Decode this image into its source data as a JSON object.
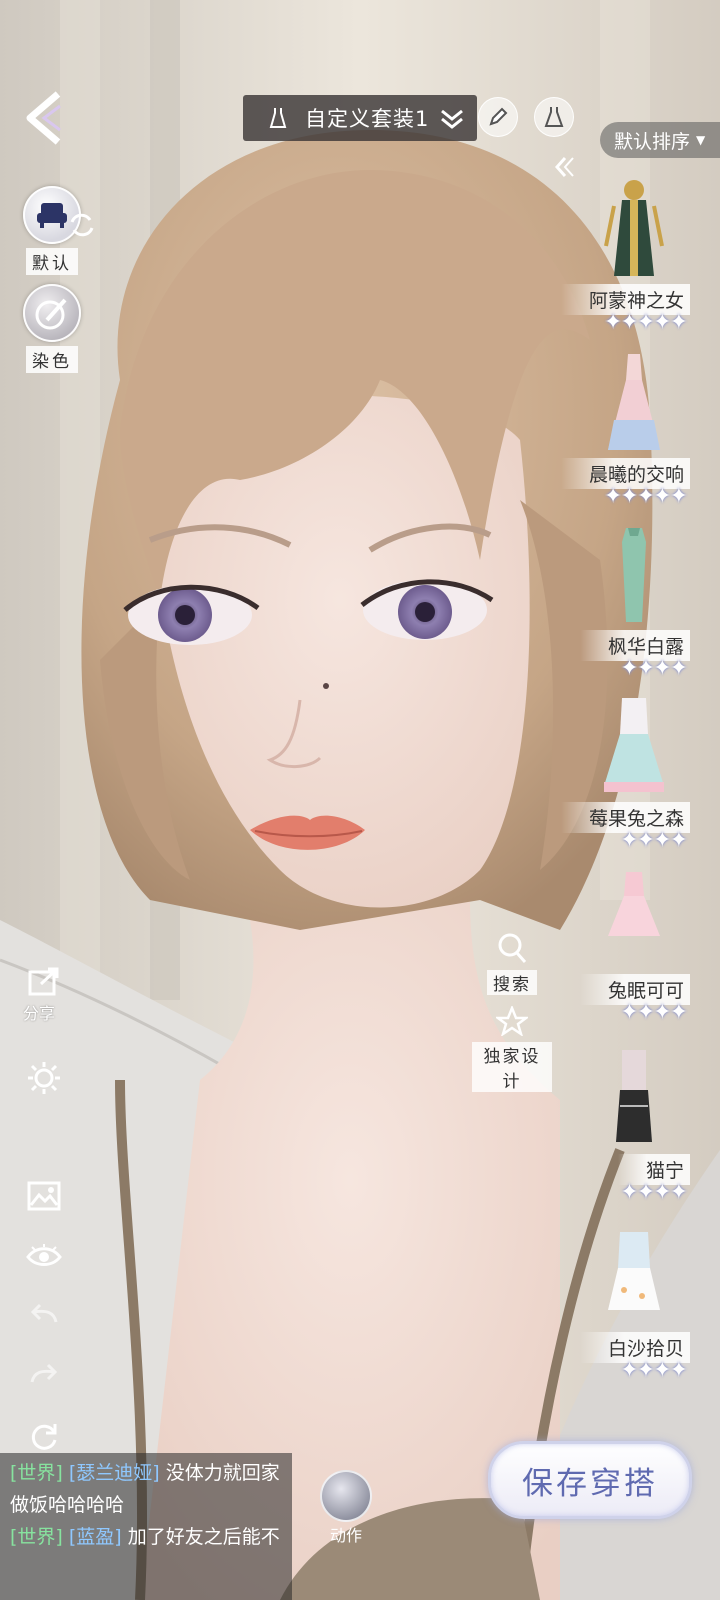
{
  "header": {
    "outfit_name": "自定义套装1",
    "sort_label": "默认排序"
  },
  "left_tools": [
    {
      "name": "default",
      "label": "默认",
      "icon": "sofa-icon"
    },
    {
      "name": "dye",
      "label": "染色",
      "icon": "palette-icon"
    }
  ],
  "side_icons": {
    "share_label": "分享",
    "icons": [
      "share-icon",
      "brightness-icon",
      "image-icon",
      "eye-icon",
      "undo-icon",
      "redo-icon",
      "reset-icon"
    ]
  },
  "outfits": [
    {
      "name": "阿蒙神之女",
      "stars": "✦✦✦✦✦",
      "star_count": 5
    },
    {
      "name": "晨曦的交响",
      "stars": "✦✦✦✦✦",
      "star_count": 5
    },
    {
      "name": "枫华白露",
      "stars": "✦✦✦✦",
      "star_count": 4
    },
    {
      "name": "莓果兔之森",
      "stars": "✦✦✦✦",
      "star_count": 4
    },
    {
      "name": "兔眠可可",
      "stars": "✦✦✦✦",
      "star_count": 4
    },
    {
      "name": "猫宁",
      "stars": "✦✦✦✦",
      "star_count": 4
    },
    {
      "name": "白沙拾贝",
      "stars": "✦✦✦✦",
      "star_count": 4
    }
  ],
  "mid_buttons": {
    "search_label": "搜索",
    "exclusive_label": "独家设计"
  },
  "chat": {
    "lines": [
      {
        "channel": "[世界]",
        "user": "[瑟兰迪娅]",
        "text": "没体力就回家"
      },
      {
        "text": "做饭哈哈哈哈"
      },
      {
        "channel": "[世界]",
        "user": "[蓝盈]",
        "text": "加了好友之后能不"
      }
    ]
  },
  "action_label": "动作",
  "save_label": "保存穿搭",
  "colors": {
    "accent": "#5f6ab0",
    "chat_channel": "#87e39f",
    "chat_user": "#8fc8ff",
    "hair": "#c7a88c",
    "skin": "#f2dcd3"
  }
}
